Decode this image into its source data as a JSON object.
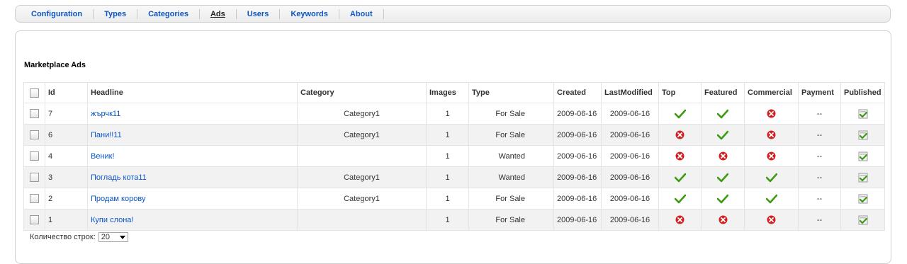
{
  "nav": {
    "items": [
      {
        "label": "Configuration"
      },
      {
        "label": "Types"
      },
      {
        "label": "Categories"
      },
      {
        "label": "Ads",
        "active": true
      },
      {
        "label": "Users"
      },
      {
        "label": "Keywords"
      },
      {
        "label": "About"
      }
    ]
  },
  "page_title": "Marketplace Ads",
  "table": {
    "columns": [
      "Id",
      "Headline",
      "Category",
      "Images",
      "Type",
      "Created",
      "LastModified",
      "Top",
      "Featured",
      "Commercial",
      "Payment",
      "Published"
    ],
    "rows": [
      {
        "id": "7",
        "headline": "жърчк11",
        "category": "Category1",
        "images": "1",
        "type": "For Sale",
        "created": "2009-06-16",
        "modified": "2009-06-16",
        "top": "check",
        "featured": "check",
        "commercial": "cross",
        "payment": "--",
        "published": "published-icon"
      },
      {
        "id": "6",
        "headline": "Пани!!11",
        "category": "Category1",
        "images": "1",
        "type": "For Sale",
        "created": "2009-06-16",
        "modified": "2009-06-16",
        "top": "cross",
        "featured": "check",
        "commercial": "cross",
        "payment": "--",
        "published": "published-icon"
      },
      {
        "id": "4",
        "headline": "Веник!",
        "category": "",
        "images": "1",
        "type": "Wanted",
        "created": "2009-06-16",
        "modified": "2009-06-16",
        "top": "cross",
        "featured": "cross",
        "commercial": "cross",
        "payment": "--",
        "published": "published-icon"
      },
      {
        "id": "3",
        "headline": "Погладь кота11",
        "category": "Category1",
        "images": "1",
        "type": "Wanted",
        "created": "2009-06-16",
        "modified": "2009-06-16",
        "top": "check",
        "featured": "check",
        "commercial": "check",
        "payment": "--",
        "published": "published-icon"
      },
      {
        "id": "2",
        "headline": "Продам корову",
        "category": "Category1",
        "images": "1",
        "type": "For Sale",
        "created": "2009-06-16",
        "modified": "2009-06-16",
        "top": "check",
        "featured": "check",
        "commercial": "check",
        "payment": "--",
        "published": "published-icon"
      },
      {
        "id": "1",
        "headline": "Купи слона!",
        "category": "",
        "images": "1",
        "type": "For Sale",
        "created": "2009-06-16",
        "modified": "2009-06-16",
        "top": "cross",
        "featured": "cross",
        "commercial": "cross",
        "payment": "--",
        "published": "published-icon"
      }
    ]
  },
  "footer": {
    "rows_label": "Количество строк:",
    "rows_value": "20"
  },
  "colors": {
    "link": "#0b55c4",
    "check": "#3c9a13",
    "cross": "#d42020"
  }
}
